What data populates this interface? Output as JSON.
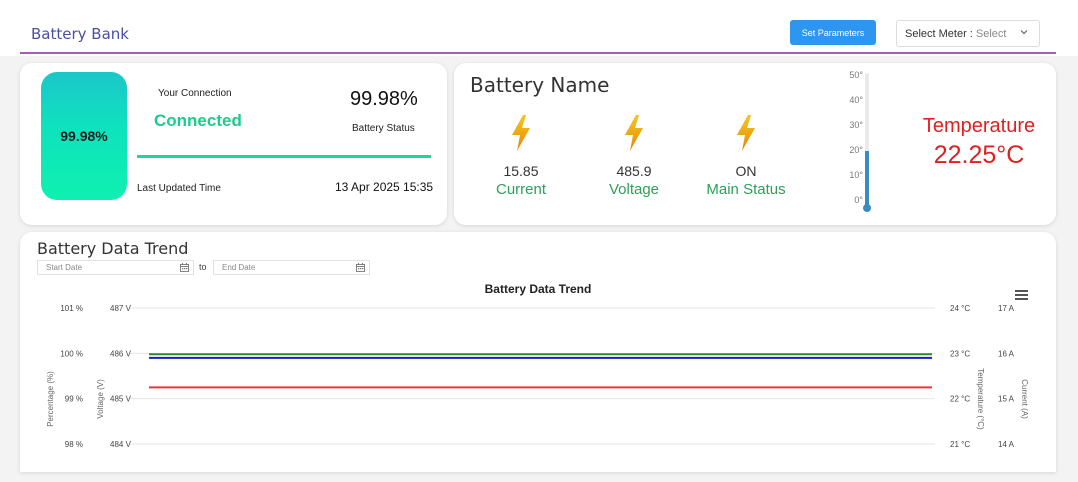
{
  "header": {
    "title": "Battery Bank",
    "set_parameters_label": "Set Parameters",
    "select_meter_label": "Select Meter :",
    "select_meter_value": "Select"
  },
  "connection_card": {
    "battery_percent": "99.98%",
    "connection_label": "Your Connection",
    "connection_value": "Connected",
    "status_percent": "99.98%",
    "status_label": "Battery Status",
    "last_updated_label": "Last Updated Time",
    "last_updated_value": "13 Apr 2025 15:35"
  },
  "battery_card": {
    "name": "Battery Name",
    "metrics": [
      {
        "value": "15.85",
        "label": "Current",
        "icon": "lightning-icon"
      },
      {
        "value": "485.9",
        "label": "Voltage",
        "icon": "lightning-icon"
      },
      {
        "value": "ON",
        "label": "Main Status",
        "icon": "lightning-icon"
      }
    ],
    "thermometer_ticks": [
      "50°",
      "40°",
      "30°",
      "20°",
      "10°",
      "0°"
    ],
    "thermometer_level_fraction": 0.445,
    "temperature_label": "Temperature",
    "temperature_value": "22.25°C"
  },
  "trend": {
    "title": "Battery Data Trend",
    "start_placeholder": "Start Date",
    "to_label": "to",
    "end_placeholder": "End Date",
    "chart_title": "Battery Data Trend"
  },
  "chart_data": {
    "type": "line",
    "title": "Battery Data Trend",
    "axes": {
      "percentage": {
        "label": "Percentage (%)",
        "unit": "%",
        "ticks": [
          101,
          100,
          99,
          98
        ],
        "range": [
          98,
          101
        ]
      },
      "voltage": {
        "label": "Voltage (V)",
        "unit": "V",
        "ticks": [
          487,
          486,
          485,
          484
        ],
        "range": [
          484,
          487
        ]
      },
      "temperature": {
        "label": "Temperature (°C)",
        "unit": "°C",
        "ticks": [
          24,
          23,
          22,
          21
        ],
        "range": [
          21,
          24
        ]
      },
      "current": {
        "label": "Current (A)",
        "unit": "A",
        "ticks": [
          17,
          16,
          15,
          14
        ],
        "range": [
          14,
          17
        ]
      }
    },
    "series": [
      {
        "axis": "percentage",
        "value": 99.98,
        "color": "#2a8a2a"
      },
      {
        "axis": "voltage",
        "value": 485.9,
        "color": "#1c1cc8"
      },
      {
        "axis": "temperature",
        "value": 22.25,
        "color": "#e03a3a"
      }
    ]
  }
}
